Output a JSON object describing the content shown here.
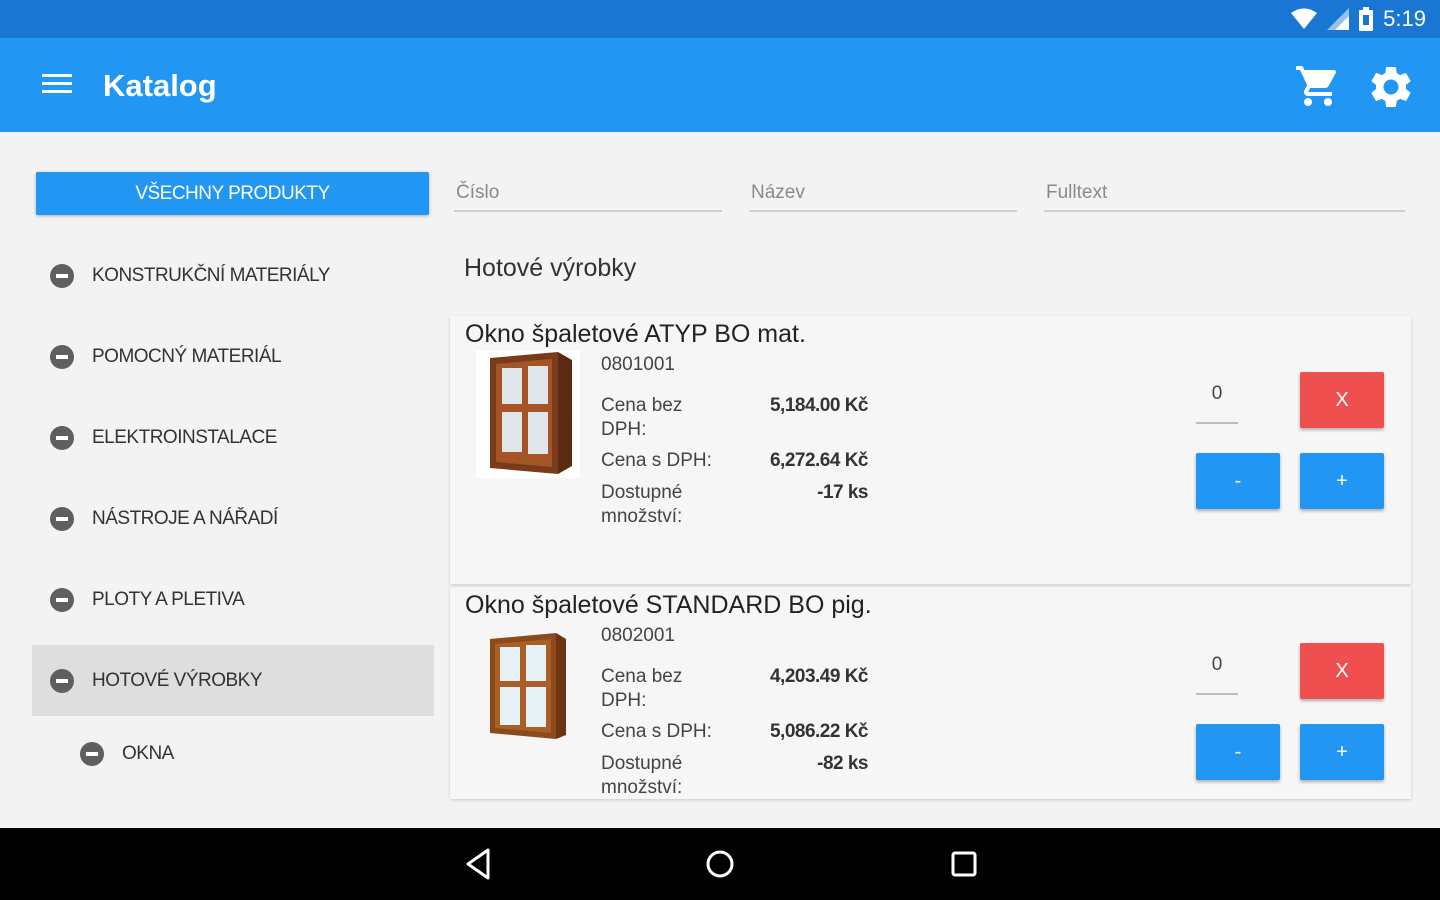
{
  "status": {
    "time": "5:19"
  },
  "app": {
    "title": "Katalog"
  },
  "nav": {
    "all_products": "VŠECHNY PRODUKTY",
    "items": [
      {
        "label": "KONSTRUKČNÍ MATERIÁLY"
      },
      {
        "label": "POMOCNÝ MATERIÁL"
      },
      {
        "label": "ELEKTROINSTALACE"
      },
      {
        "label": "NÁSTROJE A NÁŘADÍ"
      },
      {
        "label": "PLOTY A PLETIVA"
      },
      {
        "label": "HOTOVÉ VÝROBKY"
      },
      {
        "label": "OKNA"
      }
    ]
  },
  "search": {
    "number_placeholder": "Číslo",
    "name_placeholder": "Název",
    "fulltext_placeholder": "Fulltext"
  },
  "section": {
    "title": "Hotové výrobky"
  },
  "products": [
    {
      "name": "Okno špaletové ATYP BO mat.",
      "code": "0801001",
      "price_excl_label": "Cena bez DPH:",
      "price_excl": "5,184.00 Kč",
      "price_incl_label": "Cena s DPH:",
      "price_incl": "6,272.64 Kč",
      "stock_label": "Dostupné množství:",
      "stock": "-17 ks",
      "qty": "0",
      "remove_label": "X",
      "minus_label": "-",
      "plus_label": "+"
    },
    {
      "name": "Okno špaletové STANDARD BO pig.",
      "code": "0802001",
      "price_excl_label": "Cena bez DPH:",
      "price_excl": "4,203.49 Kč",
      "price_incl_label": "Cena s DPH:",
      "price_incl": "5,086.22 Kč",
      "stock_label": "Dostupné množství:",
      "stock": "-82 ks",
      "qty": "0",
      "remove_label": "X",
      "minus_label": "-",
      "plus_label": "+"
    }
  ],
  "colors": {
    "primary": "#2196f3",
    "primary_dark": "#1976d2",
    "danger": "#ef4f4f"
  }
}
